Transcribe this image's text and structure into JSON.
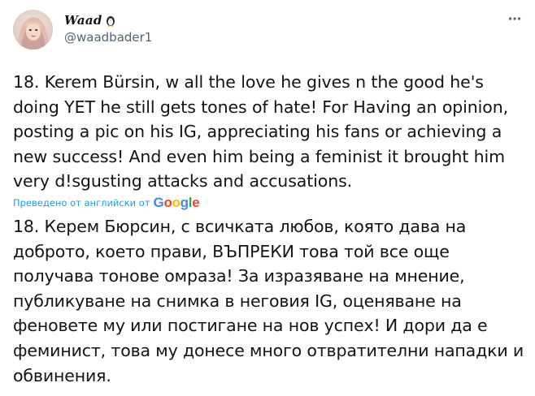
{
  "author": {
    "display_name": "Waad",
    "badge_icon": "penguin-icon",
    "handle": "@waadbader1",
    "avatar_icon": "profile-photo-woman-hijab"
  },
  "more_icon": "more-options-icon",
  "tweet": {
    "text": "18. Kerem Bürsin, w all the love he gives n the good he's doing YET he still gets tones of hate! For Having an opinion, posting a pic on his IG, appreciating his fans or achieving a new success! And even him being a feminist it brought him very d!sgusting attacks and accusations."
  },
  "translation": {
    "label": "Преведено от английски от",
    "provider": {
      "letters": [
        "G",
        "o",
        "o",
        "g",
        "l",
        "e"
      ],
      "colors": [
        "#4285F4",
        "#EA4335",
        "#FBBC05",
        "#4285F4",
        "#34A853",
        "#EA4335"
      ]
    },
    "text": "18. Керем Бюрсин, с всичката любов, която дава на доброто, което прави, ВЪПРЕКИ това той все още получава тонове омраза! За изразяване на мнение, публикуване на снимка в неговия IG, оценяване на феновете му или постигане на нов успех! И дори да е феминист, това му донесе много отвратителни нападки и обвинения."
  },
  "colors": {
    "link": "#1d9bf0",
    "secondary_text": "#536471",
    "primary_text": "#0f1419"
  }
}
